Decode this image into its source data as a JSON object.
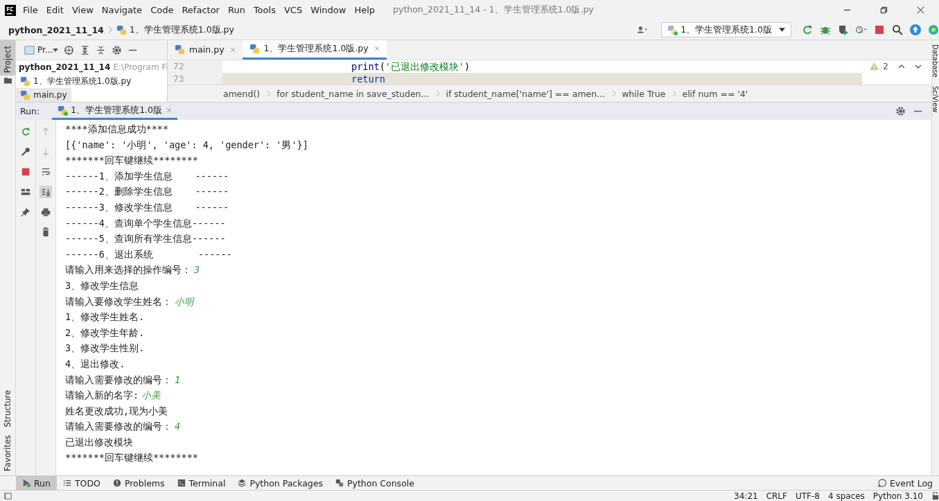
{
  "window": {
    "title": "python_2021_11_14 - 1、学生管理系统1.0版.py"
  },
  "menu": [
    "File",
    "Edit",
    "View",
    "Navigate",
    "Code",
    "Refactor",
    "Run",
    "Tools",
    "VCS",
    "Window",
    "Help"
  ],
  "breadcrumb": {
    "project": "python_2021_11_14",
    "file": "1、学生管理系统1.0版.py"
  },
  "run_config": "1、学生管理系统1.0版",
  "left_stripe": {
    "top": "Project",
    "bottom": [
      "Structure",
      "Favorites"
    ]
  },
  "right_stripe": [
    "Database",
    "SciView"
  ],
  "project_panel": {
    "title": "Pr...",
    "tree": [
      {
        "name": "python_2021_11_14",
        "path": "E:\\Program Fi",
        "children": [
          {
            "name": "1、学生管理系统1.0版.py",
            "selected": false
          },
          {
            "name": "main.py",
            "selected": true
          }
        ]
      }
    ]
  },
  "editor_tabs": [
    {
      "label": "main.py",
      "selected": false
    },
    {
      "label": "1、学生管理系统1.0版.py",
      "selected": true
    }
  ],
  "editor": {
    "lines": [
      {
        "number": "72",
        "current": false,
        "parts": [
          {
            "text": "print",
            "kind": "builtin"
          },
          {
            "text": "(",
            "kind": "punct"
          },
          {
            "text": "'已退出修改模块'",
            "kind": "string"
          },
          {
            "text": ")",
            "kind": "punct"
          }
        ]
      },
      {
        "number": "73",
        "current": true,
        "parts": [
          {
            "text": "return",
            "kind": "keyword"
          }
        ]
      }
    ],
    "warnings": "2"
  },
  "code_breadcrumbs": [
    "amend()",
    "for student_name in save_studen...",
    "if student_name['name'] == amen...",
    "while True",
    "elif num == '4'"
  ],
  "run_panel": {
    "label": "Run:",
    "tabs": [
      {
        "label": "1、学生管理系统1.0版",
        "selected": true
      }
    ],
    "console": [
      {
        "text": "****添加信息成功****"
      },
      {
        "text": "[{'name': '小明', 'age': 4, 'gender': '男'}]"
      },
      {
        "text": "*******回车键继续********"
      },
      {
        "text": "------1、添加学生信息    ------"
      },
      {
        "text": "------2、删除学生信息    ------"
      },
      {
        "text": "------3、修改学生信息    ------"
      },
      {
        "text": "------4、查询单个学生信息------"
      },
      {
        "text": "------5、查询所有学生信息------"
      },
      {
        "text": "------6、退出系统        ------"
      },
      {
        "text": "请输入用来选择的操作编号：",
        "input": "3"
      },
      {
        "text": "3、修改学生信息"
      },
      {
        "text": "请输入要修改学生姓名：",
        "input": "小明"
      },
      {
        "text": "1、修改学生姓名."
      },
      {
        "text": "2、修改学生年龄."
      },
      {
        "text": "3、修改学生性别."
      },
      {
        "text": "4、退出修改."
      },
      {
        "text": "请输入需要修改的编号：",
        "input": "1"
      },
      {
        "text": "请输入新的名字:",
        "input": "小美"
      },
      {
        "text": "姓名更改成功,现为小美"
      },
      {
        "text": "请输入需要修改的编号：",
        "input": "4"
      },
      {
        "text": "已退出修改模块"
      },
      {
        "text": "*******回车键继续********"
      }
    ]
  },
  "tool_tabs": [
    {
      "label": "Run",
      "selected": true
    },
    {
      "label": "TODO",
      "selected": false
    },
    {
      "label": "Problems",
      "selected": false
    },
    {
      "label": "Terminal",
      "selected": false
    },
    {
      "label": "Python Packages",
      "selected": false
    },
    {
      "label": "Python Console",
      "selected": false
    }
  ],
  "event_log": "Event Log",
  "status_bar": [
    "34:21",
    "CRLF",
    "UTF-8",
    "4 spaces",
    "Python 3.10"
  ]
}
